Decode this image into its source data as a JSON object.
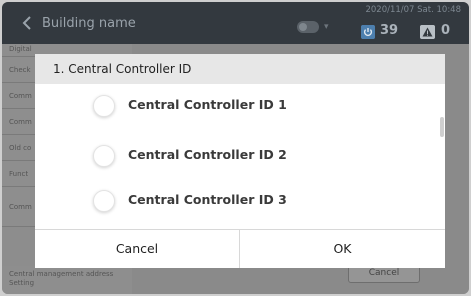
{
  "header": {
    "building_name": "Building name",
    "datetime": "2020/11/07 Sat. 10:48",
    "power_count": "39",
    "alert_count": "0",
    "icons": [
      "back-arrow-icon",
      "toggle-icon",
      "power-icon",
      "warning-icon"
    ]
  },
  "background": {
    "list_items": [
      "Digital",
      "Check",
      "Comm",
      "Comm",
      "Old co",
      "Funct",
      "Comm",
      "Central management address Setting"
    ],
    "cancel_label": "Cancel"
  },
  "dialog": {
    "title": "1. Central Controller ID",
    "options": [
      {
        "label": "Central Controller ID 1"
      },
      {
        "label": "Central Controller ID 2"
      },
      {
        "label": "Central Controller ID 3"
      }
    ],
    "cancel_label": "Cancel",
    "ok_label": "OK"
  }
}
